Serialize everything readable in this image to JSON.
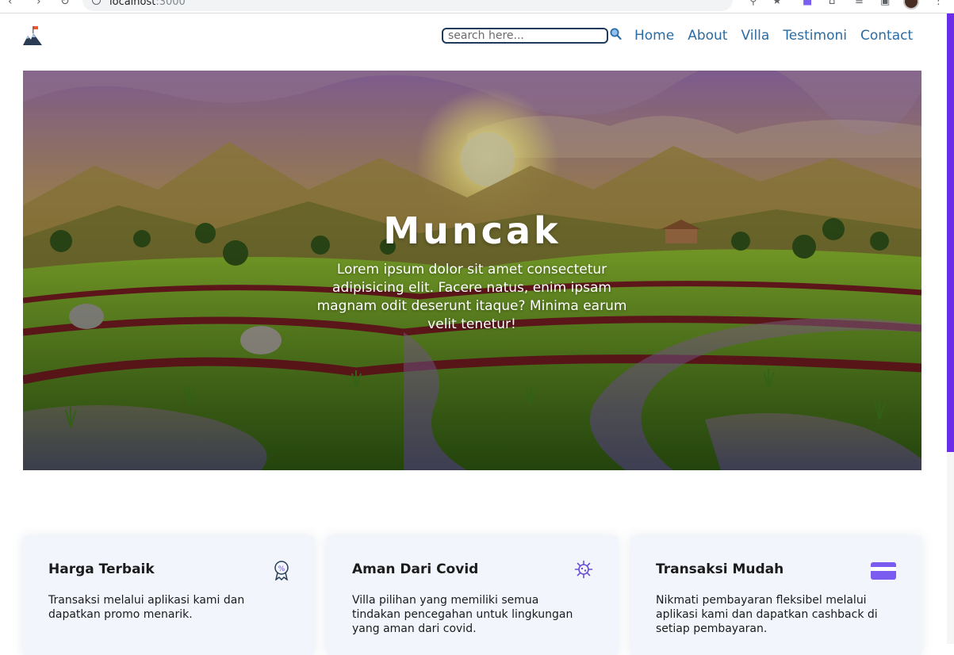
{
  "browser": {
    "url_host": "localhost",
    "url_port": ":3000"
  },
  "header": {
    "search": {
      "placeholder": "search here..."
    },
    "nav": [
      {
        "label": "Home"
      },
      {
        "label": "About"
      },
      {
        "label": "Villa"
      },
      {
        "label": "Testimoni"
      },
      {
        "label": "Contact"
      }
    ]
  },
  "hero": {
    "title": "Muncak",
    "text": "Lorem ipsum dolor sit amet consectetur adipisicing elit. Facere natus, enim ipsam magnam odit deserunt itaque? Minima earum velit tenetur!"
  },
  "features": [
    {
      "title": "Harga Terbaik",
      "text": "Transaksi melalui aplikasi kami dan dapatkan promo menarik.",
      "icon": "discount-badge-icon"
    },
    {
      "title": "Aman Dari Covid",
      "text": "Villa pilihan yang memiliki semua tindakan pencegahan untuk lingkungan yang aman dari covid.",
      "icon": "virus-icon"
    },
    {
      "title": "Transaksi Mudah",
      "text": "Nikmati pembayaran fleksibel melalui aplikasi kami dan dapatkan cashback di setiap pembayaran.",
      "icon": "credit-card-icon"
    }
  ],
  "colors": {
    "nav_link": "#2a6ca3",
    "card_bg": "#f2f6fc",
    "scrollbar": "#6b2ee8",
    "icon_accent": "#6a4fd8"
  }
}
